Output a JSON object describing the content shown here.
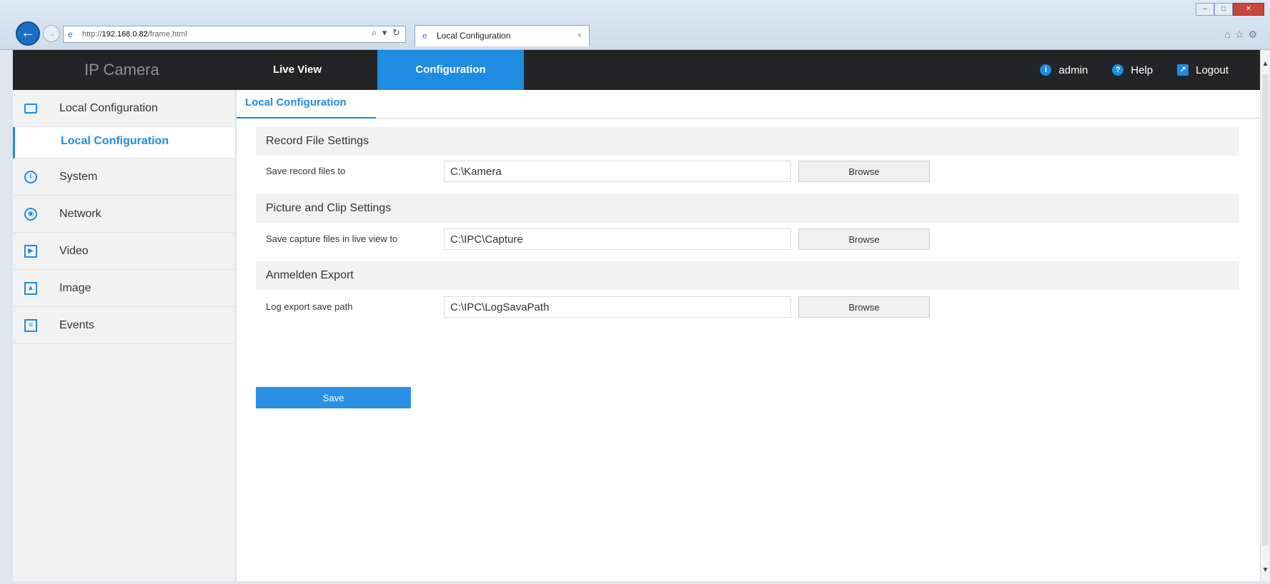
{
  "browser": {
    "url_prefix": "http://",
    "url_host": "192.168.0.82",
    "url_path": "/frame.html",
    "address_tools": "⌕ ▾ ↻",
    "tab_title": "Local Configuration",
    "tab_close": "×"
  },
  "header": {
    "brand": "IP Camera",
    "nav": {
      "live_view": "Live View",
      "configuration": "Configuration"
    },
    "user": "admin",
    "help": "Help",
    "logout": "Logout"
  },
  "sidebar": {
    "items": [
      {
        "label": "Local Configuration",
        "icon": "monitor-icon"
      },
      {
        "label": "System",
        "icon": "info-icon"
      },
      {
        "label": "Network",
        "icon": "globe-icon"
      },
      {
        "label": "Video",
        "icon": "video-icon"
      },
      {
        "label": "Image",
        "icon": "image-icon"
      },
      {
        "label": "Events",
        "icon": "events-icon"
      }
    ],
    "active_sub": "Local Configuration"
  },
  "main": {
    "tab": "Local Configuration",
    "sections": [
      {
        "title": "Record File Settings",
        "label": "Save record files to",
        "value": "C:\\Kamera",
        "button": "Browse"
      },
      {
        "title": "Picture and Clip Settings",
        "label": "Save capture files in live view to",
        "value": "C:\\IPC\\Capture",
        "button": "Browse"
      },
      {
        "title": "Anmelden Export",
        "label": "Log export save path",
        "value": "C:\\IPC\\LogSavaPath",
        "button": "Browse"
      }
    ],
    "save_label": "Save"
  },
  "colors": {
    "accent": "#1e8ce0",
    "header_bg": "#222426",
    "sidebar_bg": "#f2f2f2"
  }
}
